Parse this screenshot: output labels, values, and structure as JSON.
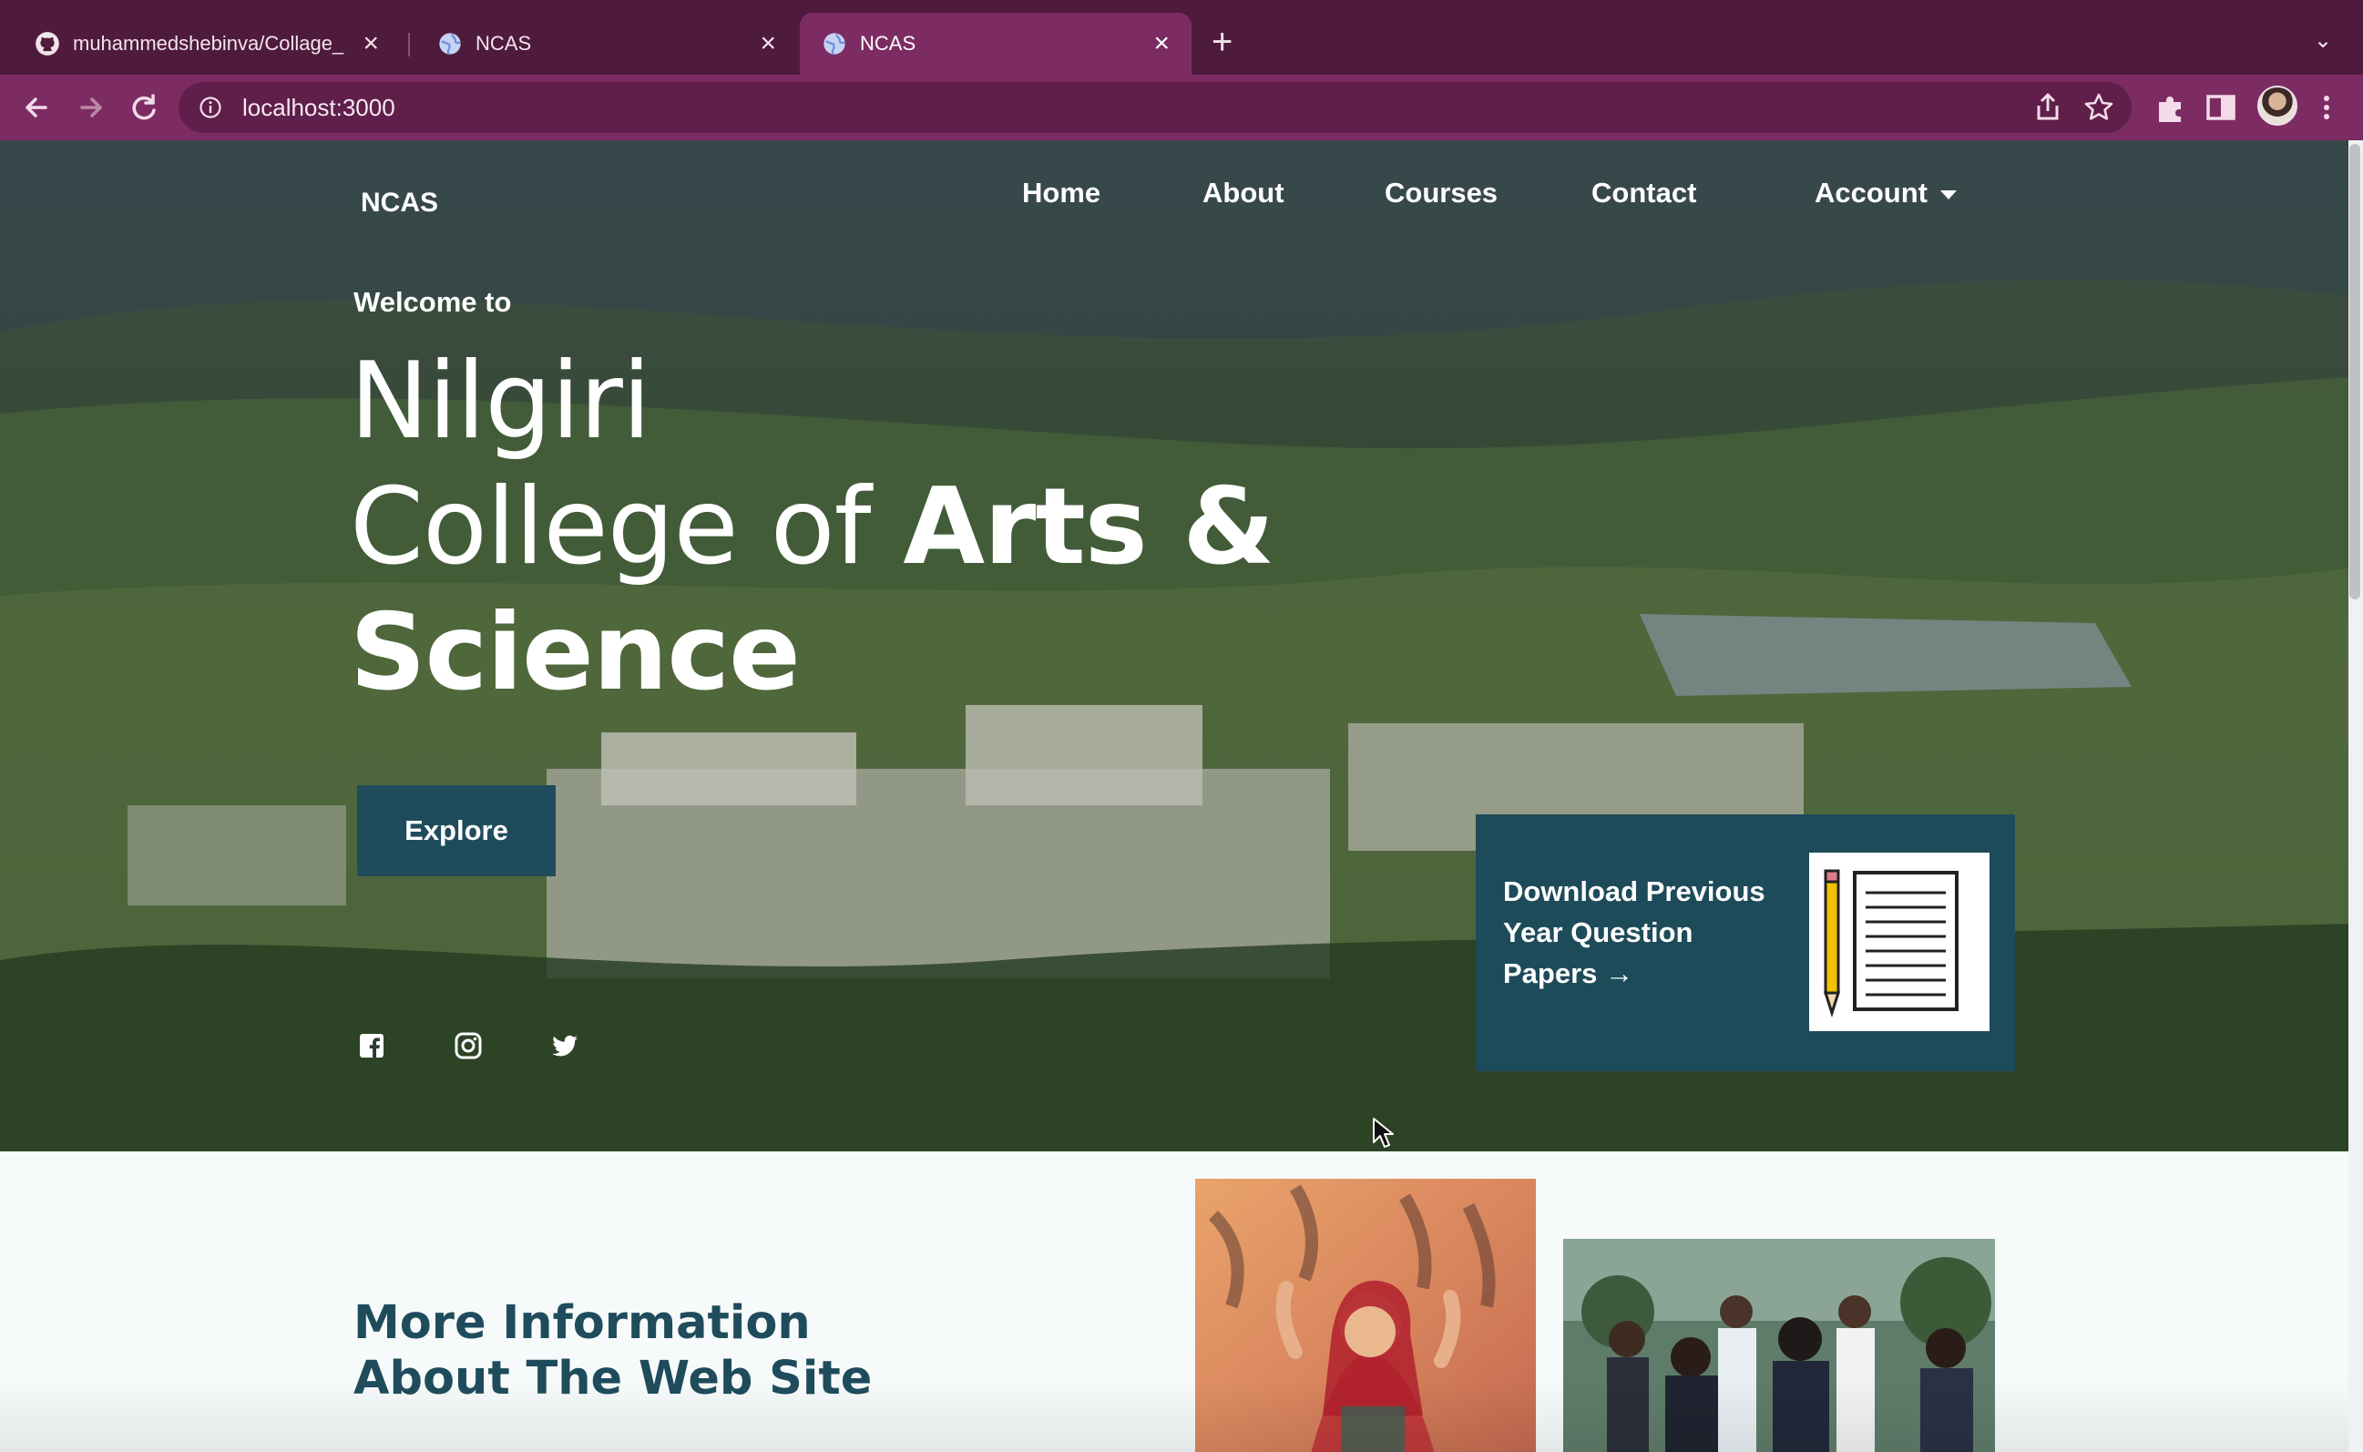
{
  "browser": {
    "tabs": [
      {
        "title": "muhammedshebinva/Collage_",
        "close": "×",
        "active": false
      },
      {
        "title": "NCAS",
        "close": "×",
        "active": false
      },
      {
        "title": "NCAS",
        "close": "×",
        "active": true
      }
    ],
    "new_tab": "+",
    "url": "localhost:3000"
  },
  "site": {
    "brand": "NCAS",
    "nav": {
      "home": "Home",
      "about": "About",
      "courses": "Courses",
      "contact": "Contact",
      "account": "Account"
    },
    "hero": {
      "welcome": "Welcome to",
      "line1": "Nilgiri",
      "line2_regular": "College of ",
      "line2_bold": "Arts &",
      "line3_bold": "Science",
      "explore_label": "Explore"
    },
    "promo": {
      "text": "Download Previous Year Question Papers",
      "arrow": "→"
    },
    "social": [
      "facebook-icon",
      "instagram-icon",
      "twitter-icon"
    ],
    "section": {
      "heading_line1": "More Information",
      "heading_line2": "About The Web Site"
    }
  },
  "colors": {
    "tab_bar": "#4f1b3c",
    "toolbar": "#7d2c63",
    "accent": "#1f4c5c",
    "page_bg": "#f7fafa"
  }
}
